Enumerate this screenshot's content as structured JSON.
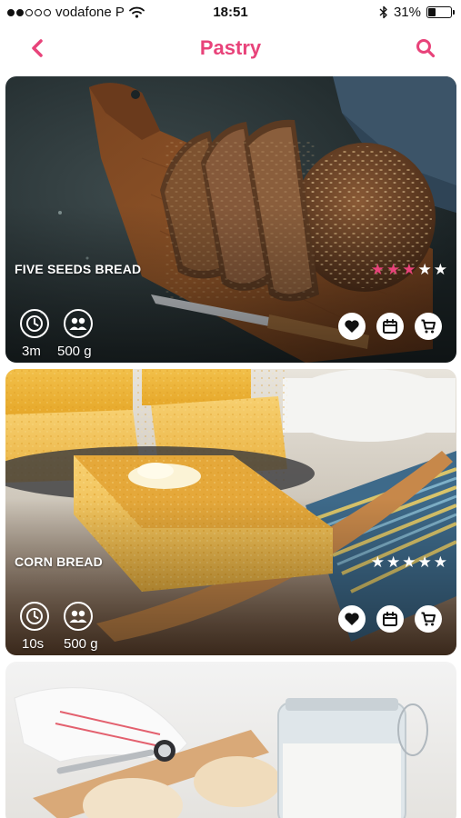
{
  "colors": {
    "accent": "#e8437a",
    "star_empty": "#ffffff"
  },
  "status_bar": {
    "carrier": "vodafone P",
    "time": "18:51",
    "battery": "31%",
    "battery_level": 0.31,
    "signal_bars": 2
  },
  "nav": {
    "title": "Pastry",
    "back_icon": "chevron-left-icon",
    "search_icon": "search-icon"
  },
  "recipes": [
    {
      "title": "FIVE SEEDS BREAD",
      "time": "3m",
      "weight": "500 g",
      "rating": 3,
      "rating_max": 5,
      "icons": [
        "clock-icon",
        "people-icon",
        "heart-icon",
        "calendar-icon",
        "cart-icon"
      ]
    },
    {
      "title": "CORN BREAD",
      "time": "10s",
      "weight": "500 g",
      "rating": 0,
      "rating_max": 5,
      "icons": [
        "clock-icon",
        "people-icon",
        "heart-icon",
        "calendar-icon",
        "cart-icon"
      ]
    }
  ]
}
